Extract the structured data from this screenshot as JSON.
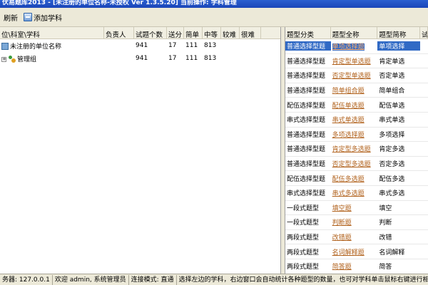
{
  "window": {
    "title": "伏易题库2013 - [未注册的单位名称-未授权 Ver 1.3.5.20]  当前操作: 学科管理"
  },
  "toolbar": {
    "refresh_label": "刷新",
    "add_subject_label": "添加学科"
  },
  "left_table": {
    "headers": [
      "位\\科室\\学科",
      "负责人",
      "试题个数",
      "送分",
      "简单",
      "中等",
      "较难",
      "很难"
    ],
    "rows": [
      {
        "name": "未注册的单位名称",
        "owner": "",
        "count": "941",
        "send": "17",
        "simple": "111",
        "mid": "813",
        "hard": "",
        "vhard": ""
      },
      {
        "name": "管理组",
        "owner": "",
        "count": "941",
        "send": "17",
        "simple": "111",
        "mid": "813",
        "hard": "",
        "vhard": ""
      }
    ]
  },
  "right_table": {
    "headers": [
      "题型分类",
      "题型全称",
      "题型简称",
      "试题"
    ],
    "rows": [
      {
        "category": "普通选择型题",
        "full": "单项选择题",
        "short": "单项选择"
      },
      {
        "category": "普通选择型题",
        "full": "肯定型单选题",
        "short": "肯定单选"
      },
      {
        "category": "普通选择型题",
        "full": "否定型单选题",
        "short": "否定单选"
      },
      {
        "category": "普通选择型题",
        "full": "简单组合题",
        "short": "简单组合"
      },
      {
        "category": "配伍选择型题",
        "full": "配伍单选题",
        "short": "配伍单选"
      },
      {
        "category": "串式选择型题",
        "full": "串式单选题",
        "short": "串式单选"
      },
      {
        "category": "普通选择型题",
        "full": "多项选择题",
        "short": "多项选择"
      },
      {
        "category": "普通选择型题",
        "full": "肯定型多选题",
        "short": "肯定多选"
      },
      {
        "category": "普通选择型题",
        "full": "否定型多选题",
        "short": "否定多选"
      },
      {
        "category": "配伍选择型题",
        "full": "配伍多选题",
        "short": "配伍多选"
      },
      {
        "category": "串式选择型题",
        "full": "串式多选题",
        "short": "串式多选"
      },
      {
        "category": "一段式题型",
        "full": "填空题",
        "short": "填空"
      },
      {
        "category": "一段式题型",
        "full": "判断题",
        "short": "判断"
      },
      {
        "category": "两段式题型",
        "full": "改错题",
        "short": "改错"
      },
      {
        "category": "两段式题型",
        "full": "名词解释题",
        "short": "名词解释"
      },
      {
        "category": "两段式题型",
        "full": "简答题",
        "short": "简答"
      }
    ]
  },
  "statusbar": {
    "server": "务器: 127.0.0.1",
    "welcome": "欢迎 admin, 系统管理员",
    "mode": "连接模式: 直通",
    "hint": "选择左边的学科，右边窗口会自动统计各种题型的数量，也可对学科单击鼠标右键进行相关操作"
  },
  "colors": {
    "selection": "#316ac5",
    "link": "#b0601a",
    "titlebar": "#2a5fd0"
  }
}
